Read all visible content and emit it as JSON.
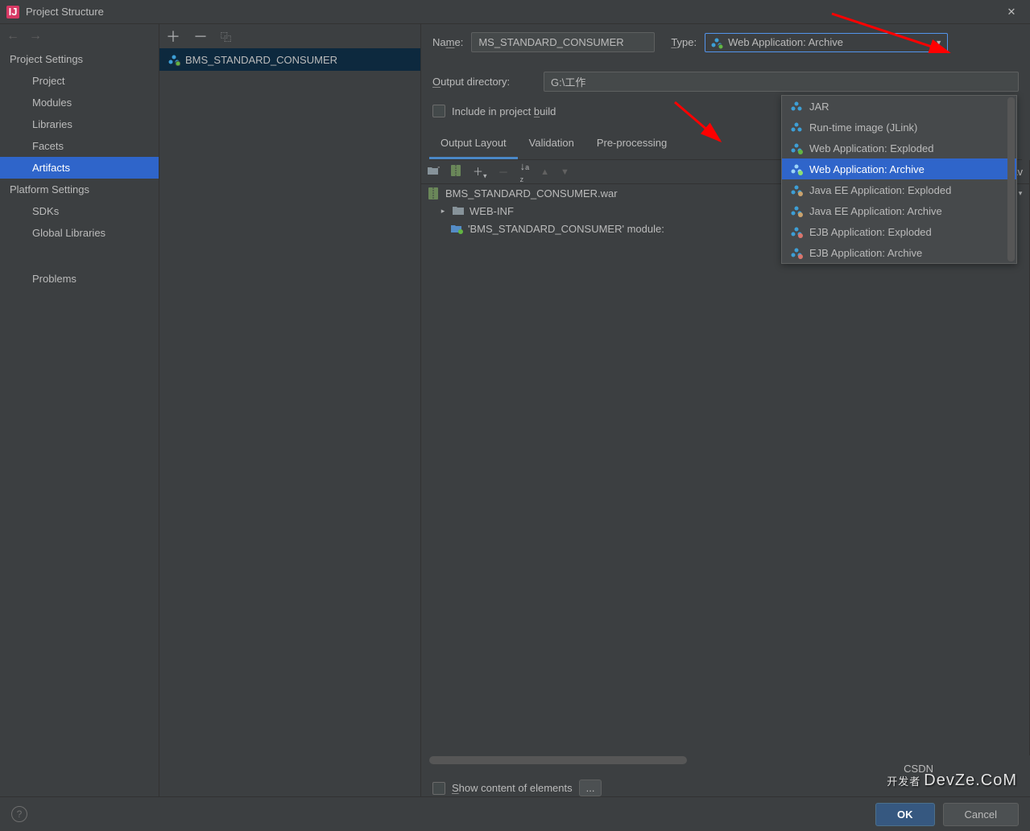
{
  "window": {
    "title": "Project Structure"
  },
  "sidebar": {
    "projectSettings": {
      "header": "Project Settings",
      "items": [
        "Project",
        "Modules",
        "Libraries",
        "Facets",
        "Artifacts"
      ]
    },
    "platformSettings": {
      "header": "Platform Settings",
      "items": [
        "SDKs",
        "Global Libraries"
      ]
    },
    "problems": "Problems"
  },
  "artifactList": {
    "items": [
      "BMS_STANDARD_CONSUMER"
    ]
  },
  "form": {
    "nameLabel": "Name:",
    "nameValue": "MS_STANDARD_CONSUMER",
    "typeLabel": "Type:",
    "typeValue": "Web Application: Archive",
    "outputDirLabel": "Output directory:",
    "outputDirValue": "G:\\工作",
    "includeBuildLabel": "Include in project build"
  },
  "tabs": {
    "items": [
      "Output Layout",
      "Validation",
      "Pre-processing"
    ]
  },
  "tree": {
    "root": "BMS_STANDARD_CONSUMER.war",
    "webinf": "WEB-INF",
    "moduleRow": "'BMS_STANDARD_CONSUMER' module:"
  },
  "availableHeader": "Av",
  "bottom": {
    "showContent": "Show content of elements",
    "ellipsis": "..."
  },
  "footer": {
    "ok": "OK",
    "cancel": "Cancel"
  },
  "dropdown": {
    "items": [
      "JAR",
      "Run-time image (JLink)",
      "Web Application: Exploded",
      "Web Application: Archive",
      "Java EE Application: Exploded",
      "Java EE Application: Archive",
      "EJB Application: Exploded",
      "EJB Application: Archive"
    ]
  },
  "watermark": {
    "main": "开发者",
    "sub": "DevZe.CoM",
    "csdn": "CSDN"
  }
}
